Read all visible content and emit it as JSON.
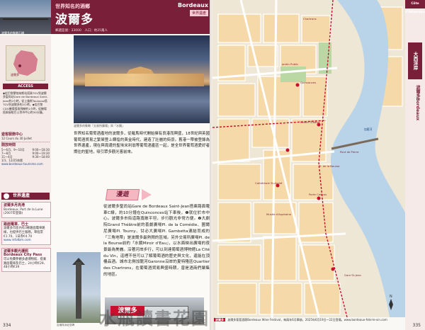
{
  "left_page": {
    "header": {
      "photo_caption": "波爾多的象徵石橋",
      "series": "世界知名的酒鄉",
      "title": "波爾多",
      "info": "郵遞區號：33000　人口：約25萬人",
      "city_en": "Bordeaux",
      "badge": "世界遺產"
    },
    "sidebar": {
      "map_label": "波爾多",
      "access_title": "ACCESS",
      "access_text": "◆從巴黎蒙帕納斯站搭乘TGV到波爾多聖尚站Gare de Bordeaux Saint-Jean約2小時，從土魯斯Toulouse搭TGV到波爾多約2小時。◆從巴黎CDG機場搭乘飛機約1小時，從機場搭乘接駁巴士到市中心約30分鐘。",
      "tourist_office_title": "遊客服務中心",
      "tourist_office_text": "12 Cours du 30 Juillet",
      "hours_title": "開放時間",
      "hours": [
        {
          "label": "5～6月、9～10月",
          "value": "9:00～18:30"
        },
        {
          "label": "7～8月",
          "value": "9:00～19:30"
        },
        {
          "label": "11～4月",
          "value": "9:30～18:00"
        }
      ],
      "closed": "1/1、12/25休館",
      "website": "www.bordeaux-tourisme.com"
    },
    "heritage_header": "世界遺產",
    "left_column": {
      "heritage_name": "波爾多月亮港",
      "heritage_en": "Bordeaux, Port de la Lune",
      "heritage_year": "(2007年登錄)",
      "tram_title": "路面電車．巴士",
      "tram_text": "波爾多市區內有3條路面電車路線，也提供巴士服務。單程票€1.70、1日券€4.70",
      "tram_site": "www.infotbm.com",
      "pass_title": "波爾多觀光護照",
      "pass_en": "Bordeaux City Pass",
      "pass_text": "可以免費參觀多處博物館、搭乘路面電車及巴士，24小時€29、48小時€39"
    },
    "photo_caption": "波爾多的象徵「交易所廣場」與「水鏡」",
    "intro": "世界知名葡萄酒產地的波爾多，從羅馬時代開始擁有良港而興盛，18世紀與英國葡萄酒貿易之繁榮登上輝煌的黃金時代，建造了壯麗的街景。舊港一帶被登錄為世界遺產，現在與周遭的聖埃米利翁等葡萄酒產區一起，是全世界葡萄酒愛好者嚮往的聖地，吸引眾多觀光客前來。",
    "walk_banner": "漫遊",
    "walk_text": "從波爾多聖尚站Gare de Bordeaux Saint-Jean搭乘路面電車C線，約10分鐘在Quinconces站下車後，❶就位於市中心。波爾多市街道路寬敞平坦，步行觀光非常方便。❷大劇院Grand Théâtre前的喜劇廣場Pl. de la Comédie、圖爾尼廣場Pl. Tourny、甘必大廣場Pl. Gambetta連結而成的「三角地帶」是波爾多最熱鬧的區域。另外交易所廣場Pl. de la Bourse前的「水鏡Miroir d'Eau」，以水面映出廣場的夜景最為美麗。沿著河岸步行，可以到達葡萄酒博物館La Cité du Vin，這裡不但可以了解葡萄酒的歷史與文化，還能在頂樓品酒。城市北側加龍河Garonne沿岸的夏特隆區Quartier des Chartrons，在葡萄酒貿易興盛時期，曾是酒商們聚集的地區。",
    "statue_caption": "吉倫特派紀念碑",
    "tram_banner": "波爾多",
    "page_number": "334",
    "watermark": "水瓶讀書花園"
  },
  "right_page": {
    "region_tag": "Côte d'Atlantique",
    "side_label": "大西洋岸",
    "side_label_en": "波爾多Bordeaux",
    "map": {
      "river_label": "加龍河",
      "labels": [
        "Quinconces",
        "Grand Théâtre",
        "Pl. de la Bourse",
        "Cathédrale St-André",
        "Gare St-Jean",
        "Jardin Public",
        "Chartrons",
        "Pont de Pierre",
        "Musée d'Aquitaine",
        "Porte Cailhau"
      ]
    },
    "footer_badge": "波爾多",
    "footer_text": "波爾多葡萄酒節Bordeaux Wine Festival，每兩年6月舉辦，2025年6月19日～22日登場。www.bordeaux-fete-le-vin.com",
    "page_number": "335"
  },
  "colors": {
    "brand": "#7a1f3a",
    "accent_pink": "#f4b8c3",
    "tram_red": "#c8102e",
    "river": "#b9d3e8"
  }
}
